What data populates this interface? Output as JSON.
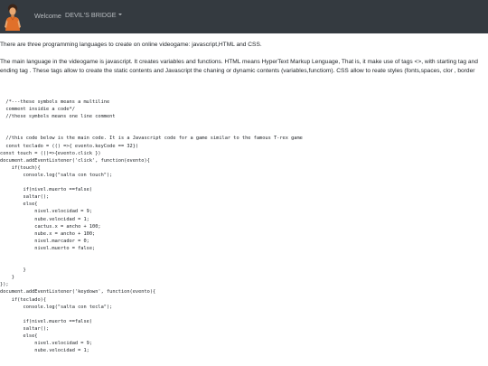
{
  "navbar": {
    "welcome_text": "Welcome",
    "user_menu_label": "DEVIL'S BRIDGE"
  },
  "content": {
    "paragraph_1": "There are three programming languages to create on online videogame: javascript,HTML and CSS.",
    "paragraph_2": "The main language in the videogame is javascript. It creates variables and functions. HTML means HyperText Markup Lenguage, That is, it make use of tags <>, with starting tag and ending tag . These tags allow to create the static contents and Javascript the chaning or dynamic contents (variables,functiom). CSS allow to reate styles (fonts,spaces, clor , border",
    "code_block": "  /*---these symbols means a multiline\n  comment insidie a code*/\n  //these symbols means one line comment\n\n\n  //this code below is the main code. It is a Javascript code for a game similar to the famous T-rex game\n  const teclado = (() =>{ evento.keyCode == 32})\nconst touch = (()=>{evento.click })\ndocument.addEventListener('click', function(evento){\n    if(touch){\n        console.log(\"salta con touch\");\n\n        if(nivel.muerto ==false)\n        saltar();\n        else{\n            nivel.velocidad = 9;\n            nube.velocidad = 1;\n            cactus.x = ancho + 100;\n            nube.x = ancho + 100;\n            nivel.marcador = 0;\n            nivel.muerto = false;\n\n\n        }\n    }\n});\ndocument.addEventListener('keydown', function(evento){\n    if(teclado){\n        console.log(\"salta con tecla\");\n\n        if(nivel.muerto ==false)\n        saltar();\n        else{\n            nivel.velocidad = 9;\n            nube.velocidad = 1;"
  }
}
